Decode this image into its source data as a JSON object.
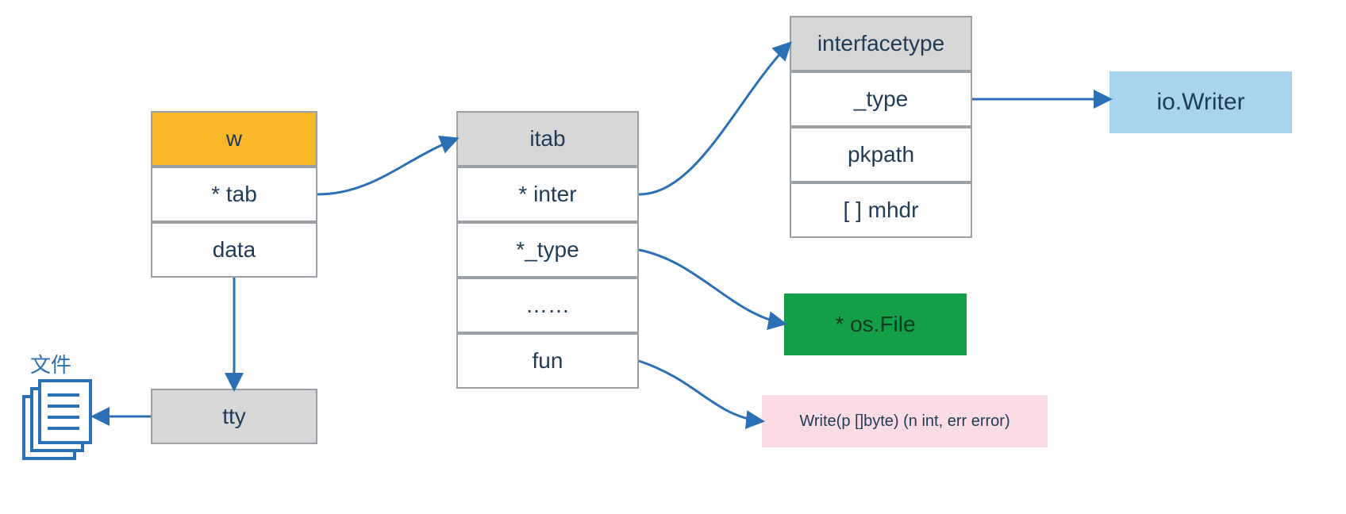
{
  "file_label": "文件",
  "w": {
    "title": "w",
    "fields": [
      "* tab",
      "data"
    ]
  },
  "tty": {
    "title": "tty"
  },
  "itab": {
    "title": "itab",
    "fields": [
      "* inter",
      "*_type",
      "……",
      "fun"
    ]
  },
  "interfacetype": {
    "title": "interfacetype",
    "fields": [
      "_type",
      "pkpath",
      "[ ] mhdr"
    ]
  },
  "os_file": "* os.File",
  "io_writer": "io.Writer",
  "write_sig": "Write(p []byte) (n int, err error)"
}
